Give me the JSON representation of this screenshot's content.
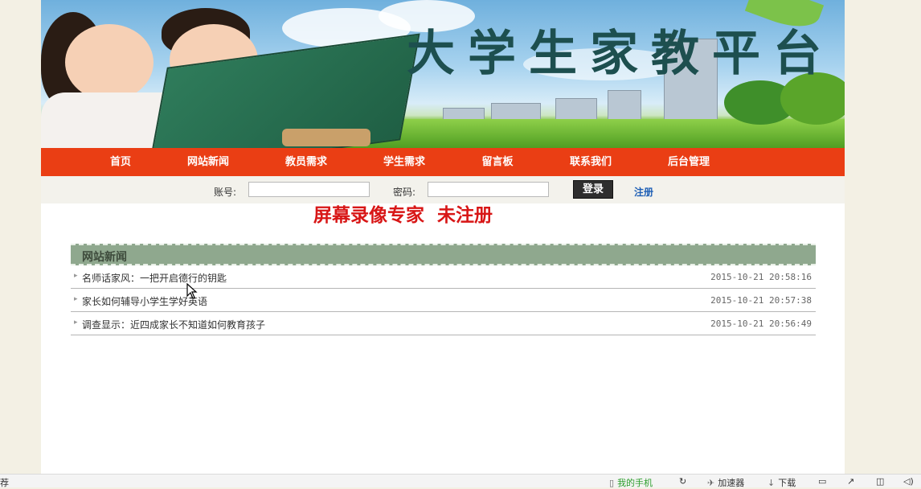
{
  "site": {
    "title": "大学生家教平台"
  },
  "nav": [
    "首页",
    "网站新闻",
    "教员需求",
    "学生需求",
    "留言板",
    "联系我们",
    "后台管理"
  ],
  "login": {
    "account_label": "账号:",
    "password_label": "密码:",
    "login_button": "登录",
    "register_link": "注册",
    "account_value": "",
    "password_value": ""
  },
  "watermark": "屏幕录像专家  未注册",
  "news": {
    "header": "网站新闻",
    "items": [
      {
        "title": "名师话家风：一把开启德行的钥匙",
        "date": "2015-10-21 20:58:16"
      },
      {
        "title": "家长如何辅导小学生学好英语",
        "date": "2015-10-21 20:57:38"
      },
      {
        "title": "调查显示：近四成家长不知道如何教育孩子",
        "date": "2015-10-21 20:56:49"
      }
    ]
  },
  "statusbar": {
    "left": "荐",
    "phone": "我的手机",
    "accelerator": "加速器",
    "download": "下载"
  },
  "colors": {
    "nav_bg": "#ea3e14",
    "title": "#1d4f4f",
    "watermark": "#d81616",
    "news_header": "#8fa88e"
  }
}
